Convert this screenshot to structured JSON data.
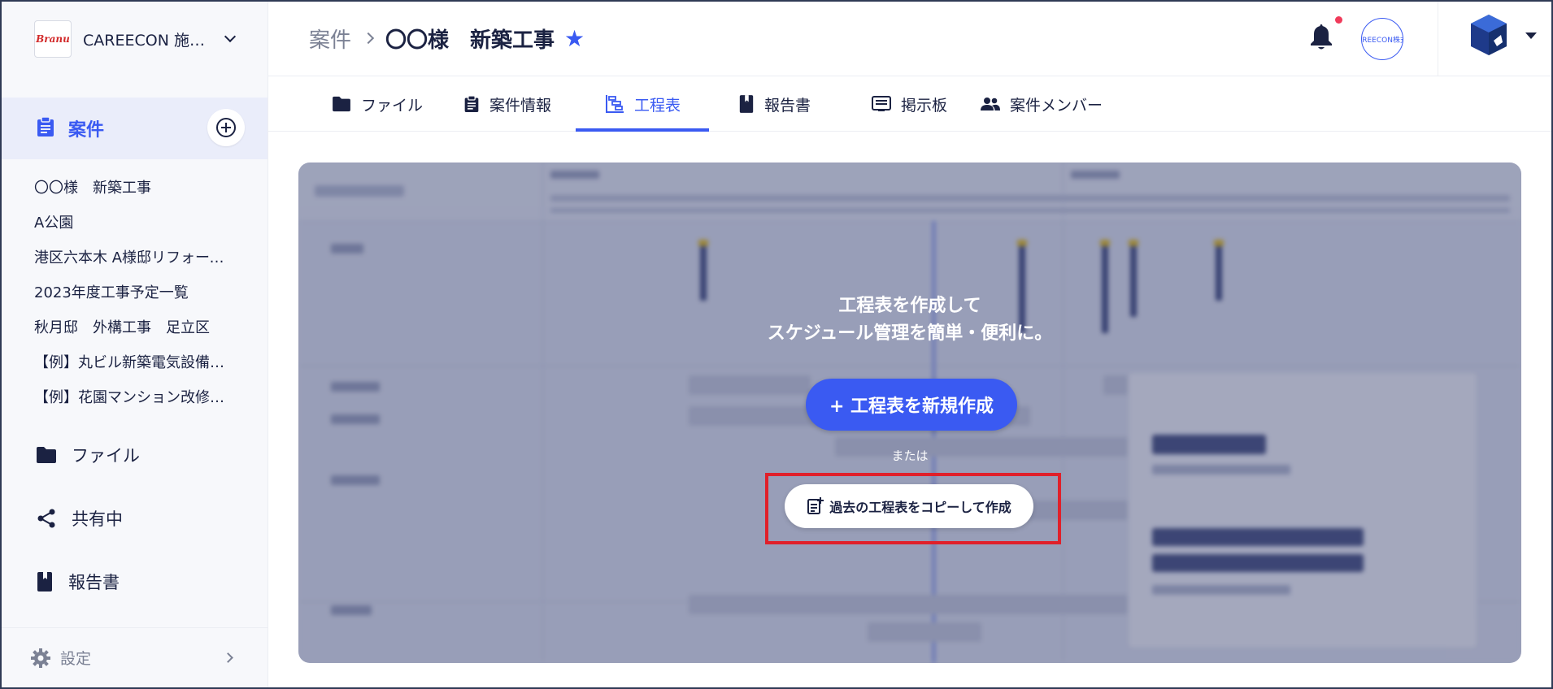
{
  "sidebar": {
    "org_name": "CAREECON 施工管理",
    "org_logo_text": "Branu",
    "active_nav_label": "案件",
    "projects": [
      "〇〇様　新築工事",
      "A公園",
      "港区六本木 A様邸リフォーム工事",
      "2023年度工事予定一覧",
      "秋月邸　外構工事　足立区",
      "【例】丸ビル新築電気設備工事",
      "【例】花園マンション改修工事"
    ],
    "nav": {
      "files": "ファイル",
      "shared": "共有中",
      "reports": "報告書"
    },
    "settings_label": "設定"
  },
  "header": {
    "breadcrumb_parent": "案件",
    "breadcrumb_current": "〇〇様　新築工事",
    "company_avatar_text": "AREECON株式"
  },
  "tabs": [
    {
      "label": "ファイル",
      "icon": "folder-icon"
    },
    {
      "label": "案件情報",
      "icon": "clipboard-icon"
    },
    {
      "label": "工程表",
      "icon": "gantt-icon"
    },
    {
      "label": "報告書",
      "icon": "book-icon"
    },
    {
      "label": "掲示板",
      "icon": "board-icon"
    },
    {
      "label": "案件メンバー",
      "icon": "people-icon"
    }
  ],
  "empty_state": {
    "line1": "工程表を作成して",
    "line2": "スケジュール管理を簡単・便利に。",
    "create_label": "+ 工程表を新規作成",
    "or_label": "または",
    "copy_label": "過去の工程表をコピーして作成"
  },
  "colors": {
    "accent": "#3a5af2",
    "highlight": "#e0202a"
  }
}
